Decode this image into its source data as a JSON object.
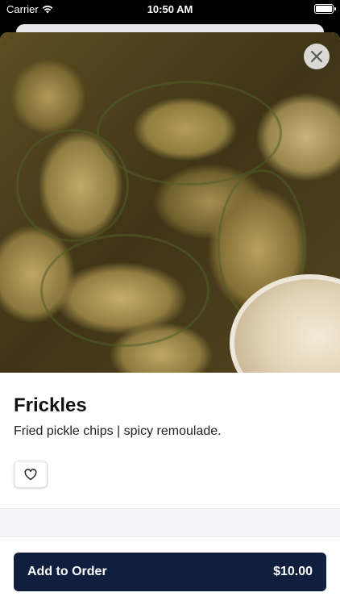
{
  "status_bar": {
    "carrier": "Carrier",
    "time": "10:50 AM"
  },
  "item": {
    "image_icon": "fried-pickles-photo",
    "title": "Frickles",
    "description": "Fried pickle chips | spicy remoulade."
  },
  "actions": {
    "close_icon": "close-icon",
    "favorite_icon": "heart-icon",
    "add_label": "Add to Order",
    "price": "$10.00"
  },
  "colors": {
    "primary": "#0f1f3d",
    "background": "#ffffff",
    "divider": "#f5f5f7"
  }
}
